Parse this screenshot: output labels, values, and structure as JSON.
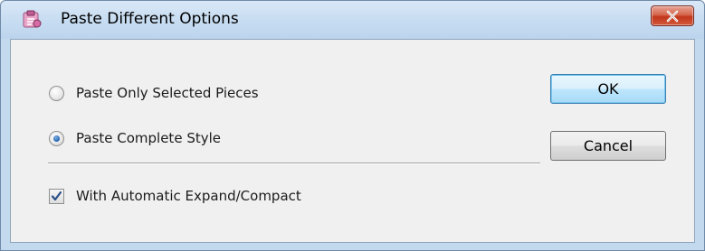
{
  "window": {
    "title": "Paste Different Options",
    "icon": "paste-app-icon",
    "close_icon": "close-icon"
  },
  "options": {
    "paste_only_selected": {
      "label": "Paste Only Selected Pieces",
      "checked": false
    },
    "paste_complete_style": {
      "label": "Paste Complete Style",
      "checked": true
    }
  },
  "auto_expand": {
    "label": "With Automatic Expand/Compact",
    "checked": true
  },
  "buttons": {
    "ok": "OK",
    "cancel": "Cancel"
  },
  "colors": {
    "client_bg": "#f0f0f0",
    "title_bg": "#c6dcf1",
    "close_red": "#c2361b",
    "accent": "#1d5fae"
  }
}
